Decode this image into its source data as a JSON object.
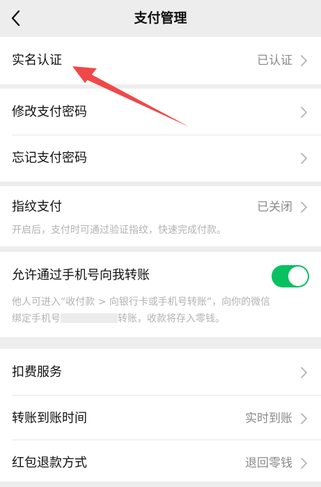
{
  "header": {
    "title": "支付管理"
  },
  "sections": {
    "verify": {
      "label": "实名认证",
      "value": "已认证"
    },
    "password": {
      "modify_label": "修改支付密码",
      "forgot_label": "忘记支付密码"
    },
    "fingerprint": {
      "label": "指纹支付",
      "value": "已关闭",
      "desc": "开启后，支付时可通过验证指纹，快速完成付款。"
    },
    "phone_transfer": {
      "label": "允许通过手机号向我转账",
      "enabled": true,
      "desc_line1": "他人可进入“收付款 > 向银行卡或手机号转账”，向你的微信",
      "desc_line2_prefix": "绑定手机号",
      "desc_line2_suffix": "转账，收款将存入零钱。"
    },
    "services": {
      "deduct_label": "扣费服务",
      "arrival_label": "转账到账时间",
      "arrival_value": "实时到账",
      "refund_label": "红包退款方式",
      "refund_value": "退回零钱"
    }
  },
  "colors": {
    "background": "#ededed",
    "toggle_on": "#07c160",
    "annotation_arrow": "#f04848"
  },
  "icons": {
    "back": "chevron-left-icon",
    "row_arrow": "chevron-right-icon"
  }
}
